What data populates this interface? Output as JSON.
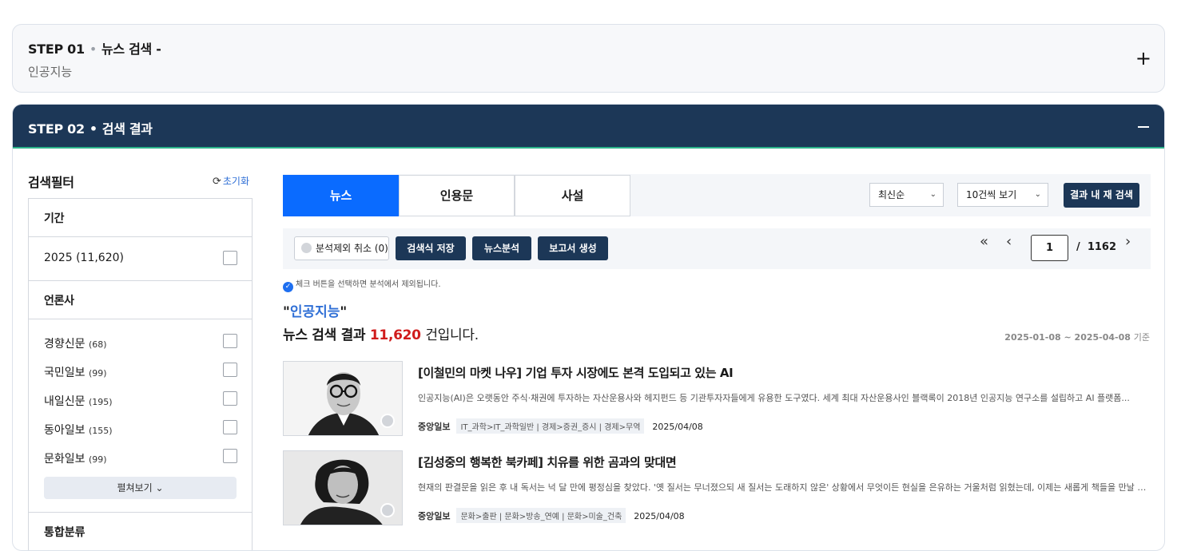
{
  "step1": {
    "label": "STEP 01",
    "title": "뉴스 검색 -",
    "keyword": "인공지능",
    "toggle": "+"
  },
  "step2": {
    "label": "STEP 02",
    "title": "검색 결과"
  },
  "filter": {
    "title": "검색필터",
    "reset": "초기화",
    "period_label": "기간",
    "period_value": "2025 (11,620)",
    "press_label": "언론사",
    "press": [
      {
        "name": "경향신문",
        "count": "(68)"
      },
      {
        "name": "국민일보",
        "count": "(99)"
      },
      {
        "name": "내일신문",
        "count": "(195)"
      },
      {
        "name": "동아일보",
        "count": "(155)"
      },
      {
        "name": "문화일보",
        "count": "(99)"
      }
    ],
    "more": "펼쳐보기",
    "category_label": "통합분류"
  },
  "tabs": [
    "뉴스",
    "인용문",
    "사설"
  ],
  "sort": "최신순",
  "page_size": "10건씩 보기",
  "search_in_result": "결과 내 재 검색",
  "toolbar": {
    "exclude_cancel": "분석제외 취소 (0)",
    "save_query": "검색식 저장",
    "news_analysis": "뉴스분석",
    "create_report": "보고서 생성"
  },
  "pagination": {
    "current": "1",
    "total": "1162"
  },
  "notice": "체크 버튼을 선택하면 분석에서 제외됩니다.",
  "result": {
    "keyword": "인공지능",
    "prefix": "뉴스 검색 결과",
    "count": "11,620",
    "suffix": "건입니다.",
    "range": "2025-01-08 ~ 2025-04-08",
    "range_suffix": "기준"
  },
  "articles": [
    {
      "title": "[이철민의 마켓 나우] 기업 투자 시장에도 본격 도입되고 있는 AI",
      "snippet": "인공지능(AI)은 오랫동안 주식·채권에 투자하는 자산운용사와 헤지펀드 등 기관투자자들에게 유용한 도구였다. 세계 최대 자산운용사인 블랙록이 2018년 인공지능 연구소를 설립하고 AI 플랫폼...",
      "source": "중앙일보",
      "category": "IT_과학>IT_과학일반 | 경제>증권_증시 | 경제>무역",
      "date": "2025/04/08"
    },
    {
      "title": "[김성중의 행복한 북카페] 치유를 위한 곰과의 맞대면",
      "snippet": "현재의 판결문을 읽은 후 내 독서는 넉 달 만에 평정심을 찾았다. '옛 질서는 무너졌으되 새 질서는 도래하지 않은' 상황에서 무엇이든 현실을 은유하는 거울처럼 읽혔는데, 이제는 새롭게 책들을 만날 준비...",
      "source": "중앙일보",
      "category": "문화>출판 | 문화>방송_연예 | 문화>미술_건축",
      "date": "2025/04/08"
    }
  ]
}
